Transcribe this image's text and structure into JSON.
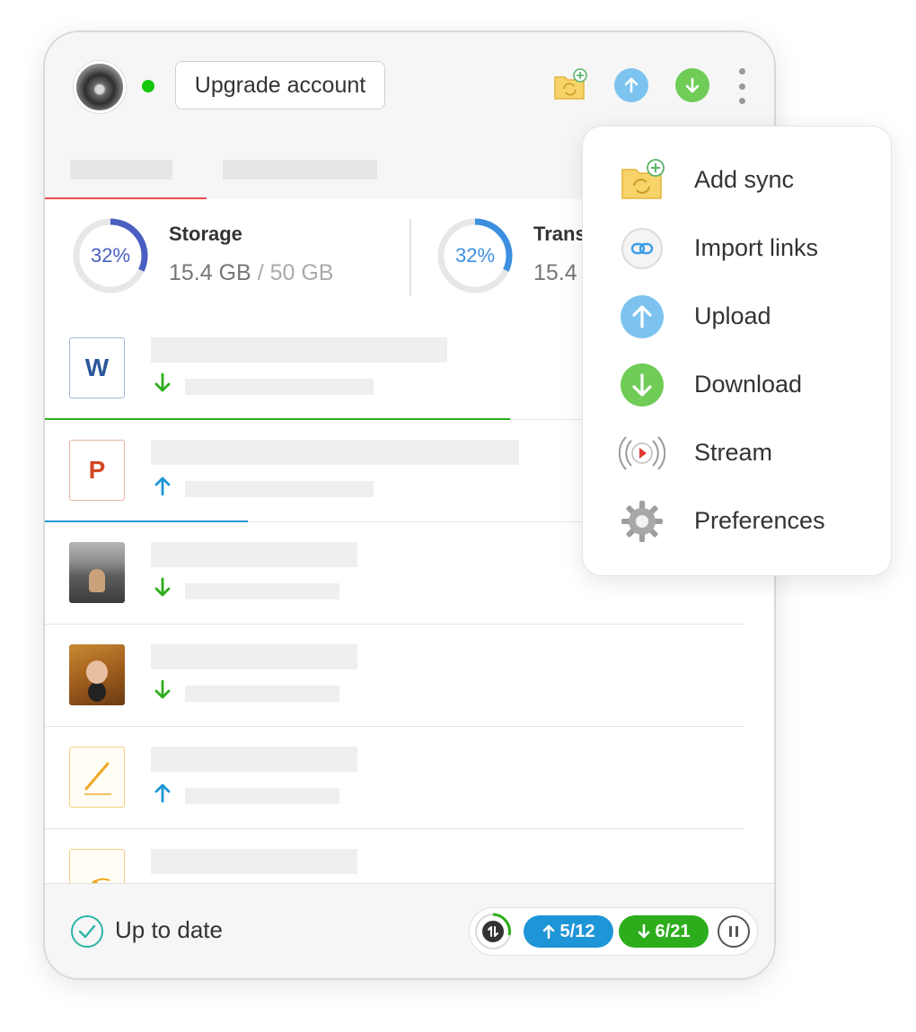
{
  "header": {
    "upgrade_label": "Upgrade account",
    "online_color": "#16c60c",
    "icons": [
      "add-sync-folder-icon",
      "upload-icon",
      "download-icon",
      "more-options-icon"
    ]
  },
  "tabs": {
    "active_underline_color": "#ef4b4b"
  },
  "stats": {
    "storage": {
      "percent_label": "32%",
      "percent": 32,
      "title": "Storage",
      "used": "15.4 GB",
      "separator": "/",
      "total": "50 GB",
      "ring_color": "#4a5fc1"
    },
    "transfer": {
      "percent_label": "32%",
      "percent": 32,
      "title": "Trans",
      "used": "15.4",
      "ring_color": "#3d8fe0"
    }
  },
  "rows": [
    {
      "thumb": "word-doc-icon",
      "letter": "W",
      "direction": "down",
      "progress": 0.71,
      "progress_color": "#2dad1c"
    },
    {
      "thumb": "powerpoint-doc-icon",
      "letter": "P",
      "direction": "up",
      "progress": 0.31,
      "progress_color": "#1e95d6"
    },
    {
      "thumb": "photo-person-bridge",
      "direction": "down"
    },
    {
      "thumb": "photo-child-autumn",
      "direction": "down"
    },
    {
      "thumb": "pencil-doc-icon",
      "direction": "up"
    },
    {
      "thumb": "vector-doc-icon",
      "direction": ""
    }
  ],
  "footer": {
    "status": "Up to date",
    "upload_count": "5/12",
    "download_count": "6/21"
  },
  "menu": {
    "items": [
      {
        "label": "Add sync",
        "icon": "add-sync-folder-icon"
      },
      {
        "label": "Import links",
        "icon": "link-icon"
      },
      {
        "label": "Upload",
        "icon": "upload-icon"
      },
      {
        "label": "Download",
        "icon": "download-icon"
      },
      {
        "label": "Stream",
        "icon": "stream-icon"
      },
      {
        "label": "Preferences",
        "icon": "gear-icon"
      }
    ]
  }
}
